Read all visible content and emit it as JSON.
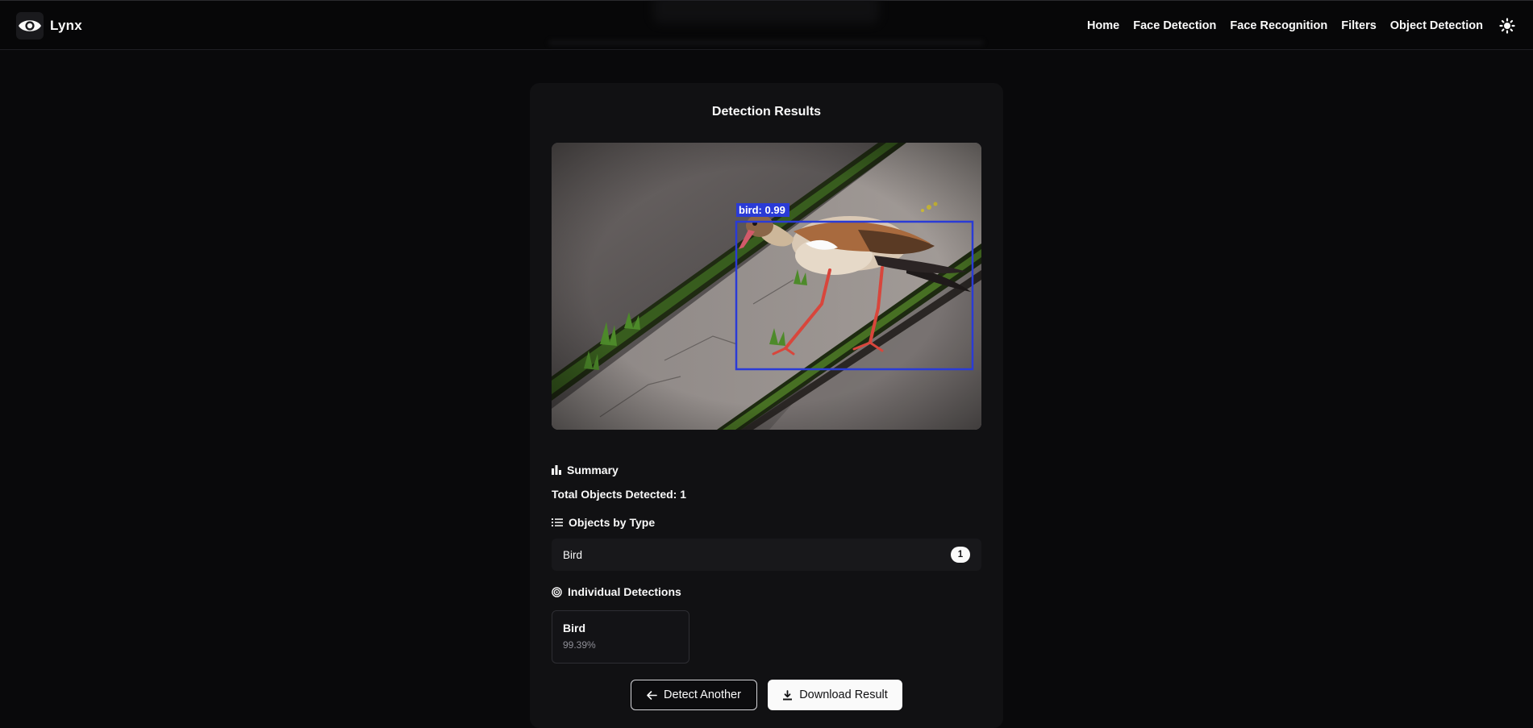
{
  "navbar": {
    "brand": "Lynx",
    "links": [
      "Home",
      "Face Detection",
      "Face Recognition",
      "Filters",
      "Object Detection"
    ],
    "icons": {
      "logo": "eye-icon",
      "theme": "sun-icon"
    }
  },
  "results": {
    "title": "Detection Results",
    "image_overlay_label": "bird: 0.99",
    "summary": {
      "heading": "Summary",
      "heading_icon": "bar-chart-icon",
      "total_label": "Total Objects Detected: 1"
    },
    "objects_by_type": {
      "heading": "Objects by Type",
      "heading_icon": "list-icon",
      "items": [
        {
          "name": "Bird",
          "count": "1"
        }
      ]
    },
    "individual": {
      "heading": "Individual Detections",
      "heading_icon": "target-icon",
      "items": [
        {
          "label": "Bird",
          "confidence": "99.39%"
        }
      ]
    },
    "buttons": {
      "detect_another": "Detect Another",
      "detect_another_icon": "arrow-left-icon",
      "download": "Download Result",
      "download_icon": "download-icon"
    }
  },
  "colors": {
    "background": "#09090b",
    "card": "#111113",
    "bbox": "#2a3bd6",
    "accent_light": "#fafafa"
  }
}
